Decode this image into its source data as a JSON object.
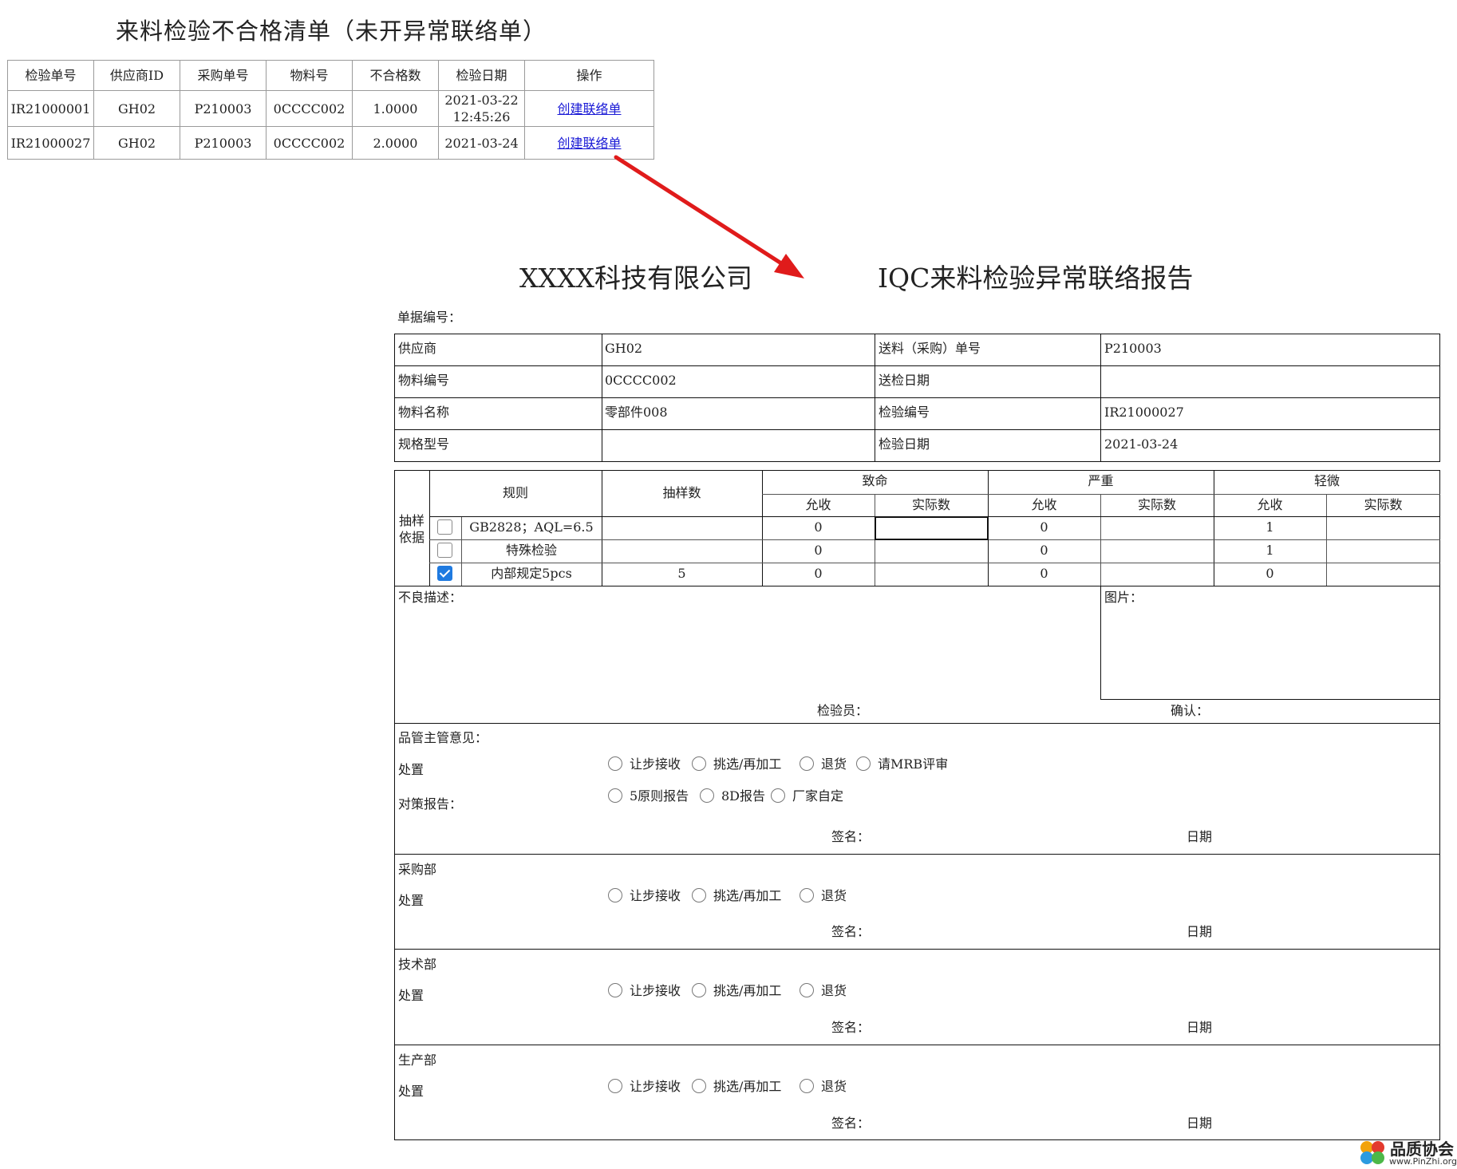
{
  "list": {
    "title": "来料检验不合格清单（未开异常联络单）",
    "headers": [
      "检验单号",
      "供应商ID",
      "采购单号",
      "物料号",
      "不合格数",
      "检验日期",
      "操作"
    ],
    "rows": [
      [
        "IR21000001",
        "GH02",
        "P210003",
        "0CCCC002",
        "1.0000",
        "2021-03-22",
        "12:45:26",
        "创建联络单"
      ],
      [
        "IR21000027",
        "GH02",
        "P210003",
        "0CCCC002",
        "2.0000",
        "2021-03-24",
        "",
        "创建联络单"
      ]
    ]
  },
  "report": {
    "company": "XXXX科技有限公司",
    "title": "IQC来料检验异常联络报告",
    "doc_no_label": "单据编号：",
    "info": [
      [
        "供应商",
        "GH02",
        "送料（采购）单号",
        "P210003"
      ],
      [
        "物料编号",
        "0CCCC002",
        "送检日期",
        ""
      ],
      [
        "物料名称",
        "零部件008",
        "检验编号",
        "IR21000027"
      ],
      [
        "规格型号",
        "",
        "检验日期",
        "2021-03-24"
      ]
    ],
    "sampling": {
      "basis_label_1": "抽样",
      "basis_label_2": "依据",
      "rule_header": "规则",
      "sample_header": "抽样数",
      "groups": [
        "致命",
        "严重",
        "轻微"
      ],
      "sub_accept": "允收",
      "sub_actual": "实际数",
      "rows": [
        {
          "rule": "GB2828；AQL=6.5",
          "checked": false,
          "sample": "",
          "fatal_accept": "0",
          "fatal_actual": "",
          "major_accept": "0",
          "major_actual": "",
          "minor_accept": "1",
          "minor_actual": ""
        },
        {
          "rule": "特殊检验",
          "checked": false,
          "sample": "",
          "fatal_accept": "0",
          "fatal_actual": "",
          "major_accept": "0",
          "major_actual": "",
          "minor_accept": "1",
          "minor_actual": ""
        },
        {
          "rule": "内部规定5pcs",
          "checked": true,
          "sample": "5",
          "fatal_accept": "0",
          "fatal_actual": "",
          "major_accept": "0",
          "major_actual": "",
          "minor_accept": "0",
          "minor_actual": ""
        }
      ]
    },
    "defect_label": "不良描述：",
    "picture_label": "图片：",
    "inspector_label": "检验员：",
    "confirm_label": "确认：",
    "qa": {
      "heading": "品管主管意见：",
      "dispose_label": "处置",
      "dispose_options": [
        "让步接收",
        "挑选/再加工",
        "退货",
        "请MRB评审"
      ],
      "report_label": "对策报告：",
      "report_options": [
        "5原则报告",
        "8D报告",
        "厂家自定"
      ],
      "sign_label": "签名：",
      "date_label": "日期"
    },
    "departments": [
      {
        "heading": "采购部",
        "dispose_label": "处置",
        "options": [
          "让步接收",
          "挑选/再加工",
          "退货"
        ],
        "sign_label": "签名：",
        "date_label": "日期"
      },
      {
        "heading": "技术部",
        "dispose_label": "处置",
        "options": [
          "让步接收",
          "挑选/再加工",
          "退货"
        ],
        "sign_label": "签名：",
        "date_label": "日期"
      },
      {
        "heading": "生产部",
        "dispose_label": "处置",
        "options": [
          "让步接收",
          "挑选/再加工",
          "退货"
        ],
        "sign_label": "签名：",
        "date_label": "日期"
      }
    ]
  },
  "watermark": {
    "name": "品质协会",
    "url": "www.PinZhi.org"
  },
  "colors": {
    "link": "#1a1ad6",
    "arrow": "#e01b1b",
    "checkbox_on": "#1f7ae0"
  }
}
